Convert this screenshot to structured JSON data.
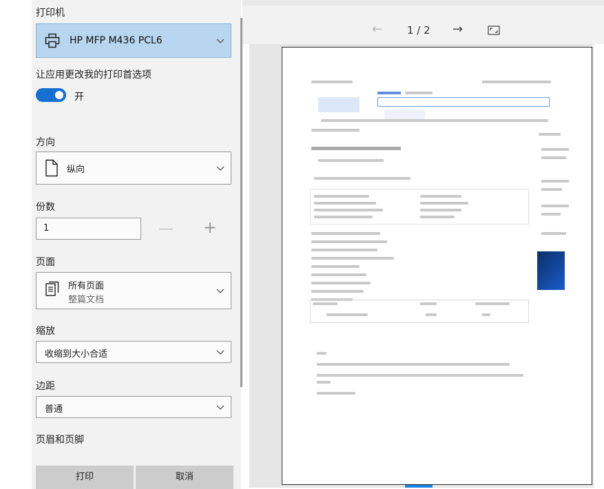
{
  "settings": {
    "printer_label": "打印机",
    "printer_value": "HP MFP M436 PCL6",
    "app_pref_label": "让应用更改我的打印首选项",
    "toggle_state": "开",
    "orientation_label": "方向",
    "orientation_value": "纵向",
    "copies_label": "份数",
    "copies_value": "1",
    "pages_label": "页面",
    "pages_value": "所有页面",
    "pages_sub": "整篇文档",
    "scale_label": "缩放",
    "scale_value": "收缩到大小合适",
    "margins_label": "边距",
    "margins_value": "普通",
    "header_footer_label": "页眉和页脚"
  },
  "buttons": {
    "print": "打印",
    "cancel": "取消"
  },
  "preview": {
    "page_indicator": "1 / 2"
  },
  "icons": {
    "printer": "printer-icon",
    "orientation": "page-icon",
    "pages": "pages-icon",
    "dropdown": "chevron-down-icon",
    "prev": "arrow-left-icon",
    "next": "arrow-right-icon",
    "fit": "fit-page-icon",
    "minus": "minus-icon",
    "plus": "plus-icon"
  },
  "colors": {
    "accent": "#1670d4",
    "selected_bg": "#b8d6ef"
  }
}
